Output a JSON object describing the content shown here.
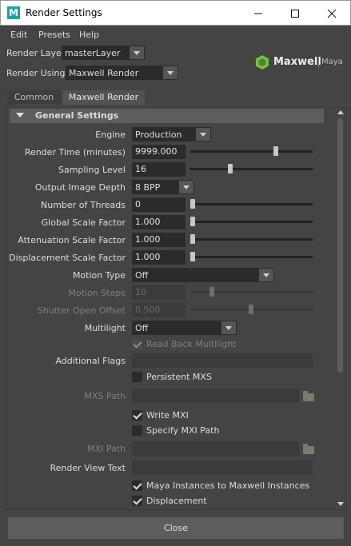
{
  "window": {
    "title": "Render Settings",
    "icon_letter": "M",
    "controls": [
      "minimize-icon",
      "maximize-icon",
      "close-icon"
    ]
  },
  "menu": {
    "items": [
      "Edit",
      "Presets",
      "Help"
    ]
  },
  "render_layer": {
    "label": "Render Layer",
    "value": "masterLayer"
  },
  "render_using": {
    "label": "Render Using",
    "value": "Maxwell Render"
  },
  "logo": {
    "brand": "Maxwell",
    "product": "Maya"
  },
  "tabs": [
    {
      "label": "Common",
      "active": false
    },
    {
      "label": "Maxwell Render",
      "active": true
    }
  ],
  "section": {
    "title": "General Settings"
  },
  "settings": {
    "engine": {
      "label": "Engine",
      "value": "Production"
    },
    "render_time": {
      "label": "Render Time (minutes)",
      "value": "9999.000",
      "slider": 0.7
    },
    "sampling_level": {
      "label": "Sampling Level",
      "value": "16",
      "slider": 0.33
    },
    "output_depth": {
      "label": "Output Image Depth",
      "value": "8 BPP"
    },
    "threads": {
      "label": "Number of Threads",
      "value": "0",
      "slider": 0.0
    },
    "global_scale": {
      "label": "Global Scale Factor",
      "value": "1.000",
      "slider": 0.0
    },
    "attenuation_scale": {
      "label": "Attenuation Scale Factor",
      "value": "1.000",
      "slider": 0.0
    },
    "displacement_scale": {
      "label": "Displacement Scale Factor",
      "value": "1.000",
      "slider": 0.0
    },
    "motion_type": {
      "label": "Motion Type",
      "value": "Off"
    },
    "motion_steps": {
      "label": "Motion Steps",
      "value": "10",
      "slider": 0.15
    },
    "shutter_open_offset": {
      "label": "Shutter Open Offset",
      "value": "0.500",
      "slider": 0.5
    },
    "multilight": {
      "label": "Multilight",
      "value": "Off"
    },
    "read_back_multilight": {
      "label": "Read Back Multilight",
      "checked": true
    },
    "additional_flags": {
      "label": "Additional Flags",
      "value": ""
    },
    "persistent_mxs": {
      "label": "Persistent MXS",
      "checked": false
    },
    "mxs_path": {
      "label": "MXS Path",
      "value": ""
    },
    "write_mxi": {
      "label": "Write MXI",
      "checked": true
    },
    "specify_mxi_path": {
      "label": "Specify MXI Path",
      "checked": false
    },
    "mxi_path": {
      "label": "MXI Path",
      "value": ""
    },
    "render_view_text": {
      "label": "Render View Text",
      "value": ""
    },
    "maya_instances": {
      "label": "Maya Instances to Maxwell Instances",
      "checked": true
    },
    "displacement": {
      "label": "Displacement",
      "checked": true
    }
  },
  "close_button": {
    "label": "Close"
  },
  "colors": {
    "window_bg": "#444444",
    "field_bg": "#2b2b2b",
    "logo_green": "#7ac143"
  }
}
